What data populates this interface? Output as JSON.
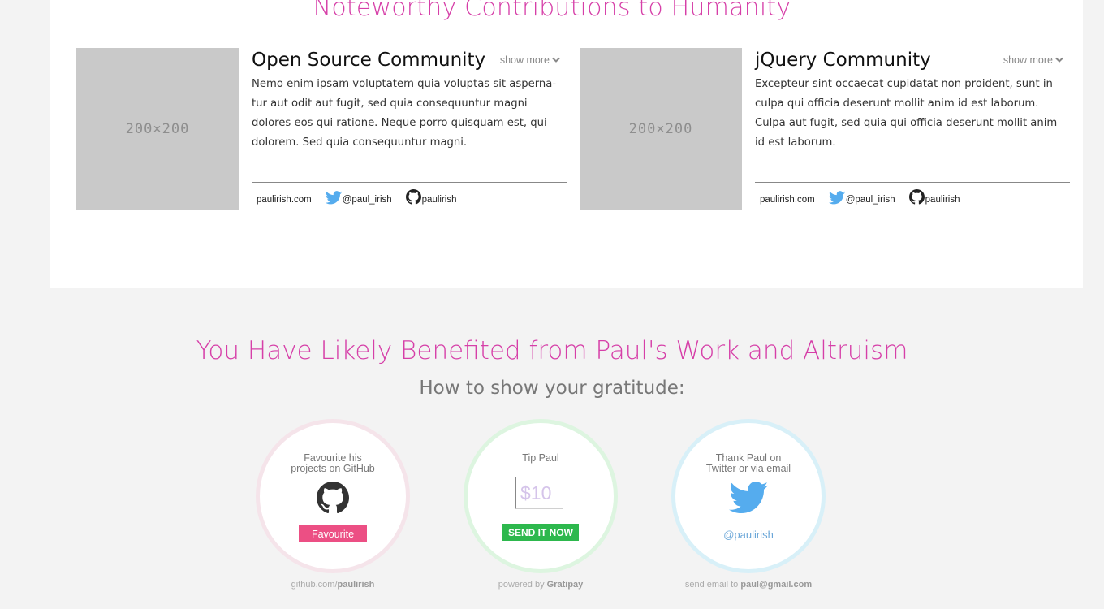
{
  "section1": {
    "title": "Noteworthy Contributions to Humanity",
    "cards": [
      {
        "thumb": "200×200",
        "title": "Open Source Community",
        "show_more": "show more",
        "description": "Nemo enim ipsam voluptatem quia voluptas sit asperna-tur aut odit aut fugit, sed quia consequuntur magni dolores eos qui ratione. Neque porro quisquam est, qui dolorem. Sed quia consequuntur magni.",
        "website": "paulirish.com",
        "twitter": "@paul_irish",
        "github": "paulirish"
      },
      {
        "thumb": "200×200",
        "title": "jQuery Community",
        "show_more": "show more",
        "description": "Excepteur sint occaecat cupidatat non proident, sunt in culpa qui officia deserunt mollit anim id est laborum. Culpa aut fugit, sed quia qui officia deserunt mollit anim id est laborum.",
        "website": "paulirish.com",
        "twitter": "@paul_irish",
        "github": "paulirish"
      }
    ]
  },
  "section2": {
    "title": "You Have Likely Benefited from Paul's Work and Altruism",
    "subtitle": "How to show your gratitude:",
    "github_card": {
      "line1": "Favourite his",
      "line2": "projects on GitHub",
      "button": "Favourite",
      "caption_prefix": "github.com/",
      "caption_bold": "paulirish"
    },
    "tip_card": {
      "line1": "Tip Paul",
      "amount_placeholder": "$10",
      "button": "SEND IT NOW",
      "caption_prefix": "powered by ",
      "caption_bold": "Gratipay"
    },
    "twitter_card": {
      "line1": "Thank Paul on",
      "line2": "Twitter or via email",
      "handle": "@paulirish",
      "caption_prefix": "send email to ",
      "caption_bold": "paul@gmail.com"
    }
  },
  "colors": {
    "accent_pink": "#d63fa8",
    "favourite_button": "#ec4f84",
    "send_button": "#2db84d",
    "twitter_blue": "#55acee",
    "github_ring": "#f5e4ea",
    "tip_ring": "#ddf5e0",
    "twitter_ring": "#d8f0f8"
  },
  "icons": [
    "chevron-down-icon",
    "twitter-bird-icon",
    "github-octocat-icon"
  ]
}
